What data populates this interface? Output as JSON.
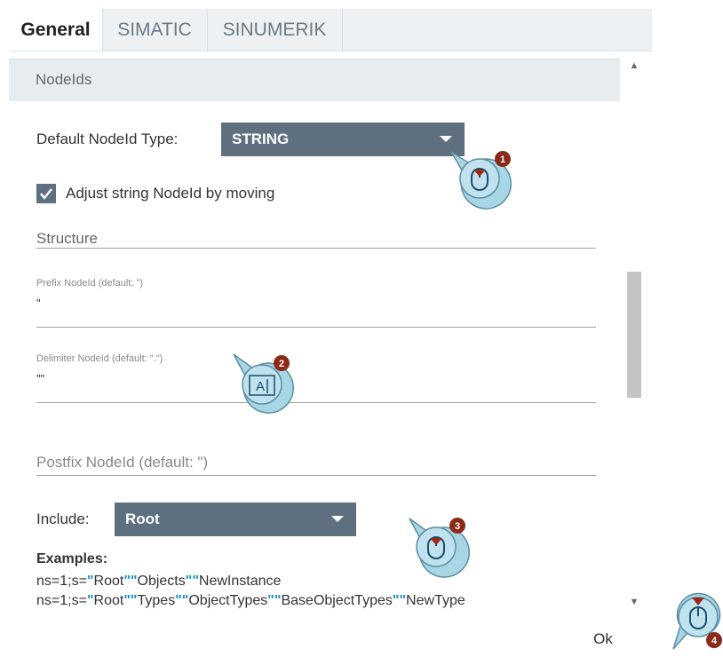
{
  "tabs": [
    {
      "label": "General",
      "active": true
    },
    {
      "label": "SIMATIC",
      "active": false
    },
    {
      "label": "SINUMERIK",
      "active": false
    }
  ],
  "section": {
    "title": "NodeIds"
  },
  "default_type": {
    "label": "Default NodeId Type:",
    "value": "STRING"
  },
  "adjust": {
    "label": "Adjust string NodeId by moving",
    "checked": true
  },
  "structure": {
    "label": "Structure"
  },
  "prefix": {
    "label": "Prefix NodeId (default: \")",
    "value": "\""
  },
  "delimiter": {
    "label": "Delimiter NodeId (default: \".\")",
    "value": "\"\""
  },
  "postfix": {
    "placeholder": "Postfix NodeId (default: \")"
  },
  "include": {
    "label": "Include:",
    "value": "Root"
  },
  "examples": {
    "title": "Examples:",
    "line1": [
      {
        "t": "ns=1;s=",
        "q": false
      },
      {
        "t": "\"",
        "q": true
      },
      {
        "t": "Root",
        "q": false
      },
      {
        "t": "\"\"",
        "q": true
      },
      {
        "t": "Objects",
        "q": false
      },
      {
        "t": "\"\"",
        "q": true
      },
      {
        "t": "NewInstance",
        "q": false
      }
    ],
    "line2": [
      {
        "t": "ns=1;s=",
        "q": false
      },
      {
        "t": "\"",
        "q": true
      },
      {
        "t": "Root",
        "q": false
      },
      {
        "t": "\"\"",
        "q": true
      },
      {
        "t": "Types",
        "q": false
      },
      {
        "t": "\"\"",
        "q": true
      },
      {
        "t": "ObjectTypes",
        "q": false
      },
      {
        "t": "\"\"",
        "q": true
      },
      {
        "t": "BaseObjectTypes",
        "q": false
      },
      {
        "t": "\"\"",
        "q": true
      },
      {
        "t": "NewType",
        "q": false
      }
    ]
  },
  "ok_button": "Ok",
  "callouts": [
    "1",
    "2",
    "3",
    "4"
  ],
  "colors": {
    "accent": "#5e707f",
    "quote": "#1e8fcf",
    "callout": "#a8d6e4",
    "badge": "#8b2a18"
  }
}
